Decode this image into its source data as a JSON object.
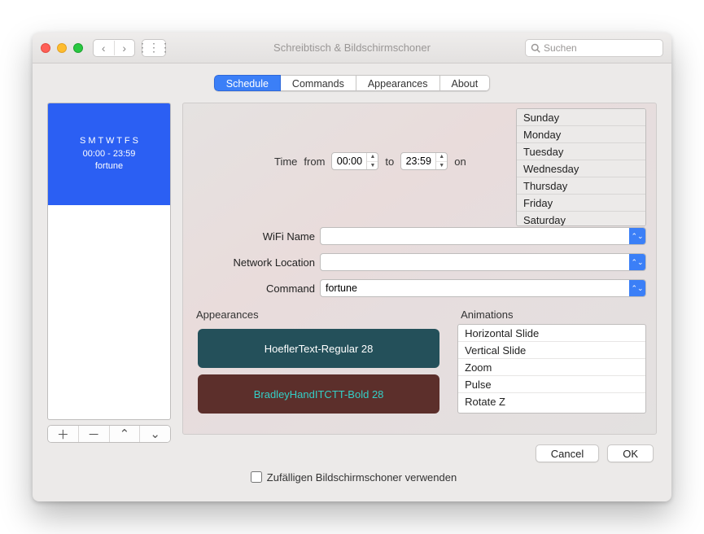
{
  "window": {
    "title": "Schreibtisch & Bildschirmschoner",
    "search_placeholder": "Suchen"
  },
  "tabs": [
    "Schedule",
    "Commands",
    "Appearances",
    "About"
  ],
  "active_tab": "Schedule",
  "preview": {
    "days": "S M T W T F S",
    "time": "00:00 - 23:59",
    "cmd": "fortune"
  },
  "time": {
    "label": "Time",
    "from_label": "from",
    "from_value": "00:00",
    "to_label": "to",
    "to_value": "23:59",
    "on_label": "on"
  },
  "days": [
    "Sunday",
    "Monday",
    "Tuesday",
    "Wednesday",
    "Thursday",
    "Friday",
    "Saturday"
  ],
  "fields": {
    "wifi_label": "WiFi Name",
    "wifi_value": "",
    "netloc_label": "Network Location",
    "netloc_value": "",
    "command_label": "Command",
    "command_value": "fortune"
  },
  "appearances": {
    "header": "Appearances",
    "items": [
      "HoeflerText-Regular 28",
      "BradleyHandITCTT-Bold 28"
    ]
  },
  "animations": {
    "header": "Animations",
    "items": [
      "Horizontal Slide",
      "Vertical Slide",
      "Zoom",
      "Pulse",
      "Rotate Z"
    ]
  },
  "buttons": {
    "cancel": "Cancel",
    "ok": "OK"
  },
  "random_checkbox": "Zufälligen Bildschirmschoner verwenden",
  "icons": {
    "add": "＋",
    "remove": "－",
    "up": "⌃",
    "down": "⌄",
    "grid": "⋮⋮⋮",
    "back": "‹",
    "fwd": "›",
    "combo_up": "▲",
    "combo_down": "▼",
    "combo_arrows": "⌃⌄"
  }
}
